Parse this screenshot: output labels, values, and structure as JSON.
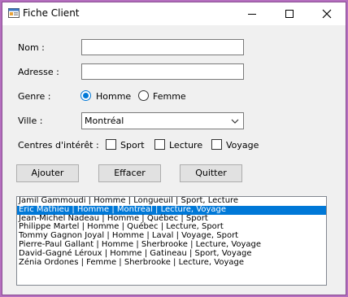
{
  "window": {
    "title": "Fiche Client"
  },
  "form": {
    "nom_label": "Nom :",
    "nom_value": "",
    "adresse_label": "Adresse :",
    "adresse_value": "",
    "genre_label": "Genre :",
    "genre_options": [
      "Homme",
      "Femme"
    ],
    "genre_selected": "Homme",
    "ville_label": "Ville :",
    "ville_value": "Montréal",
    "interets_label": "Centres d'intérêt :",
    "interets_options": [
      "Sport",
      "Lecture",
      "Voyage"
    ]
  },
  "buttons": {
    "ajouter": "Ajouter",
    "effacer": "Effacer",
    "quitter": "Quitter"
  },
  "list": {
    "items": [
      "Jamil Gammoudi | Homme | Longueuil | Sport, Lecture",
      "Éric Mathieu | Homme | Montréal | Lecture, Voyage",
      "Jean-Michel Nadeau | Homme | Québec | Sport",
      "Philippe Martel | Homme | Québec | Lecture, Sport",
      "Tommy Gagnon Joyal | Homme | Laval | Voyage, Sport",
      "Pierre-Paul Gallant | Homme | Sherbrooke | Lecture, Voyage",
      "David-Gagné Léroux | Homme | Gatineau | Sport, Voyage",
      "Zénia Ordones | Femme | Sherbrooke | Lecture, Voyage"
    ],
    "selected_index": 1
  },
  "colors": {
    "accent": "#0078d7",
    "frame": "#b56fbf"
  }
}
